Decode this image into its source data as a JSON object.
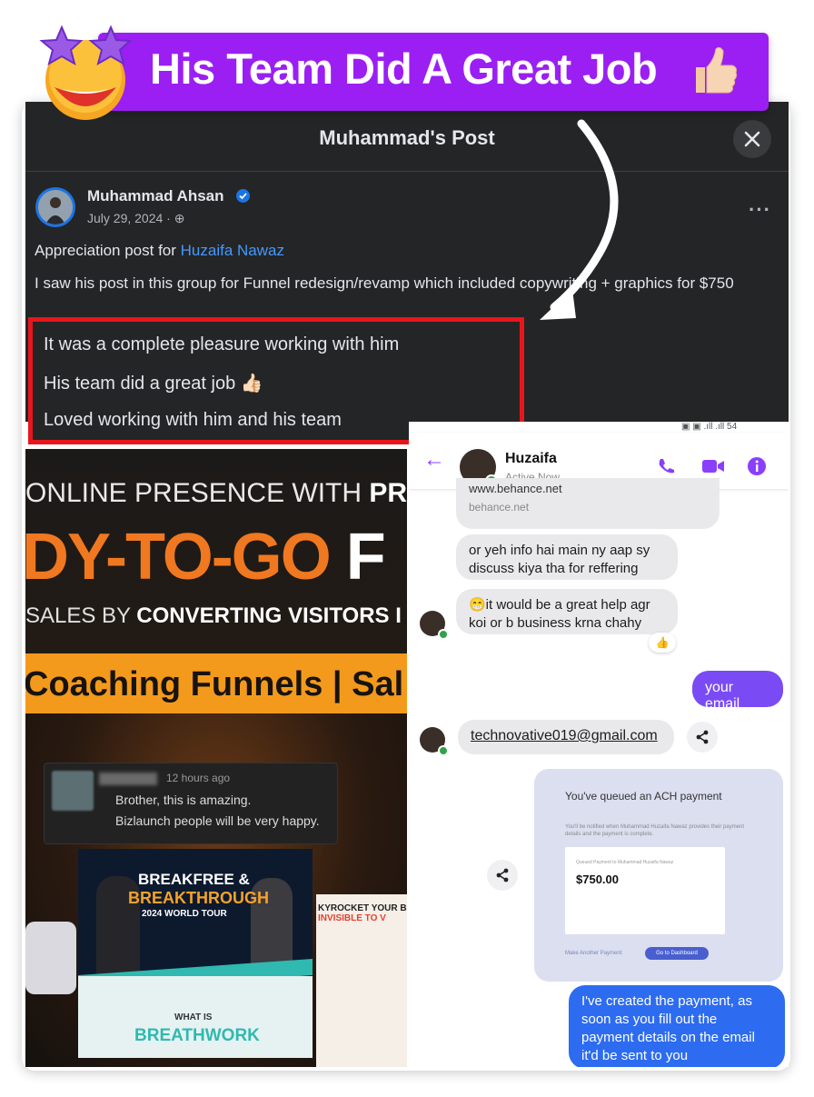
{
  "banner": {
    "title": "His Team Did A Great Job",
    "emoji_icon": "star-struck-emoji-icon",
    "thumb_icon": "thumbs-up-emoji-icon",
    "background": "#9b1ff2"
  },
  "post_modal": {
    "title": "Muhammad's Post",
    "close_icon": "close-icon",
    "author": "Muhammad Ahsan",
    "verified_icon": "verified-badge-icon",
    "date": "July 29, 2024 · ",
    "audience_icon": "globe-icon",
    "more_label": "···",
    "line1_prefix": "Appreciation post for ",
    "line1_link": "Huzaifa Nawaz",
    "line2": "I saw his post in this group for Funnel redesign/revamp which included copywriting + graphics for $750",
    "highlight_lines": [
      "It was a complete pleasure working with him",
      "His team did a great job 👍🏻",
      "Loved working with him and his team"
    ]
  },
  "promo": {
    "t1_a": "ONLINE PRESENCE WITH ",
    "t1_b": "PREM",
    "t2_a": "DY-TO-GO ",
    "t2_b": "F",
    "t3_a": "SALES BY ",
    "t3_b": "CONVERTING VISITORS I",
    "t4": "Coaching Funnels | Sal",
    "comment_time": "12 hours ago",
    "comment_line1": "Brother, this is amazing.",
    "comment_line2": "Bizlaunch people will be very happy.",
    "bf_line1": "BREAKFREE &",
    "bf_line2": "BREAKTHROUGH",
    "bf_line3": "2024 WORLD TOUR",
    "wh_line1": "WHAT IS",
    "wh_line2": "BREATHWORK",
    "side_text_a": "KYROCKET YOUR B",
    "side_text_b": "INVISIBLE TO V"
  },
  "chat": {
    "status_bar": "▣ ▣ .ıll .ıll  54",
    "back_icon": "back-arrow-icon",
    "name": "Huzaifa",
    "status": "Active Now",
    "phone_icon": "phone-icon",
    "video_icon": "video-icon",
    "info_icon": "info-icon",
    "msg_link_title": "www.behance.net",
    "msg_link_domain": "behance.net",
    "msg1": "or yeh info hai main ny aap sy discuss kiya tha for reffering",
    "msg2": "😁it would be a great help agr koi or b business krna chahy",
    "reaction": "👍",
    "me_msg": "your email",
    "email": "technovative019@gmail.com",
    "share_icon": "share-icon",
    "ach_title": "You've queued an ACH payment",
    "ach_small": "You'll be notified when Muhammad Huzaifa Nawaz provides their payment details and the payment is complete.",
    "ach_label": "Queued Payment to Muhammad Huzaifa Nawaz",
    "ach_amount": "$750.00",
    "ach_btn1": "Make Another Payment",
    "ach_btn2": "Go to Dashboard",
    "blue_msg": "I've created the payment, as soon as you fill out the payment details on the email it'd be sent to you"
  },
  "colors": {
    "fb_dark": "#242526",
    "highlight_border": "#e8161c",
    "link_blue": "#4599ff",
    "messenger_purple": "#7a4bf5",
    "orange": "#f39a1c"
  }
}
